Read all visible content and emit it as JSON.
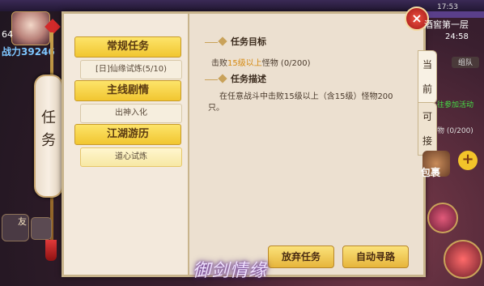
{
  "hud": {
    "level": "64",
    "power": "战力39246",
    "map_name": "酒窖第一层",
    "time": "24:58",
    "top_time": "17:53",
    "friend_label": "友",
    "pack_label": "包裹",
    "plus_label": "+",
    "right_text_1": "往参加活动",
    "right_text_2": "物 (0/200)",
    "right_button_label": "组队"
  },
  "panel": {
    "vertical_title": [
      "任",
      "务"
    ],
    "close_label": "×",
    "categories": [
      {
        "label": "常规任务",
        "items": [
          "[日]仙缘试炼(5/10)"
        ]
      },
      {
        "label": "主线剧情",
        "items": [
          "出神入化"
        ]
      },
      {
        "label": "江湖游历",
        "items": [
          "道心试炼"
        ]
      }
    ],
    "goal_title": "任务目标",
    "goal_prefix": "击败",
    "goal_highlight": "15级以上",
    "goal_suffix": "怪物 (0/200)",
    "desc_title": "任务描述",
    "desc_text": "在任意战斗中击败15级以上（含15级）怪物200只。",
    "side_tabs": [
      {
        "label": "当前",
        "active": true
      },
      {
        "label": "可接",
        "active": false
      }
    ],
    "buttons": {
      "abandon": "放弃任务",
      "auto_path": "自动寻路"
    }
  },
  "logo_text": "御剑情缘"
}
